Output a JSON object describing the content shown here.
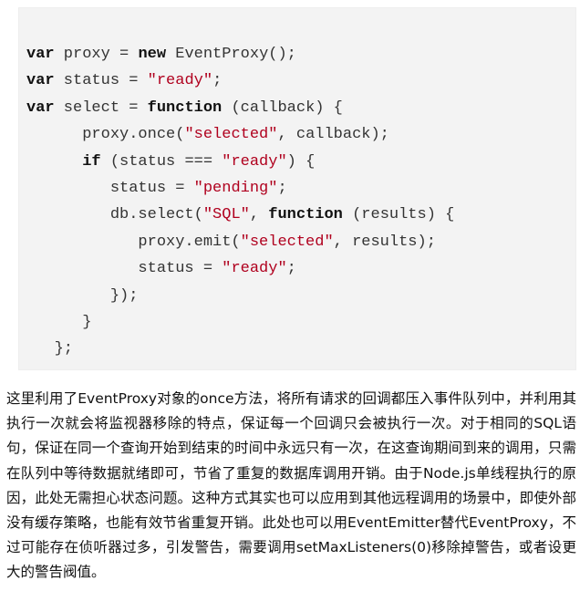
{
  "code": {
    "lines": [
      [
        {
          "t": "var",
          "k": "kw"
        },
        {
          "t": " proxy = ",
          "k": "pl"
        },
        {
          "t": "new",
          "k": "kw"
        },
        {
          "t": " EventProxy();",
          "k": "pl"
        }
      ],
      [
        {
          "t": "var",
          "k": "kw"
        },
        {
          "t": " status = ",
          "k": "pl"
        },
        {
          "t": "\"ready\"",
          "k": "str"
        },
        {
          "t": ";",
          "k": "pl"
        }
      ],
      [
        {
          "t": "var",
          "k": "kw"
        },
        {
          "t": " select = ",
          "k": "pl"
        },
        {
          "t": "function",
          "k": "kw"
        },
        {
          "t": " (callback) {",
          "k": "pl"
        }
      ],
      [
        {
          "t": "      proxy.once(",
          "k": "pl"
        },
        {
          "t": "\"selected\"",
          "k": "str"
        },
        {
          "t": ", callback);",
          "k": "pl"
        }
      ],
      [
        {
          "t": "      ",
          "k": "pl"
        },
        {
          "t": "if",
          "k": "kw"
        },
        {
          "t": " (status === ",
          "k": "pl"
        },
        {
          "t": "\"ready\"",
          "k": "str"
        },
        {
          "t": ") {",
          "k": "pl"
        }
      ],
      [
        {
          "t": "         status = ",
          "k": "pl"
        },
        {
          "t": "\"pending\"",
          "k": "str"
        },
        {
          "t": ";",
          "k": "pl"
        }
      ],
      [
        {
          "t": "         db.select(",
          "k": "pl"
        },
        {
          "t": "\"SQL\"",
          "k": "str"
        },
        {
          "t": ", ",
          "k": "pl"
        },
        {
          "t": "function",
          "k": "kw"
        },
        {
          "t": " (results) {",
          "k": "pl"
        }
      ],
      [
        {
          "t": "            proxy.emit(",
          "k": "pl"
        },
        {
          "t": "\"selected\"",
          "k": "str"
        },
        {
          "t": ", results);",
          "k": "pl"
        }
      ],
      [
        {
          "t": "            status = ",
          "k": "pl"
        },
        {
          "t": "\"ready\"",
          "k": "str"
        },
        {
          "t": ";",
          "k": "pl"
        }
      ],
      [
        {
          "t": "         });",
          "k": "pl"
        }
      ],
      [
        {
          "t": "      }",
          "k": "pl"
        }
      ],
      [
        {
          "t": "   };",
          "k": "pl"
        }
      ]
    ]
  },
  "prose": {
    "text": "这里利用了EventProxy对象的once方法，将所有请求的回调都压入事件队列中，并利用其执行一次就会将监视器移除的特点，保证每一个回调只会被执行一次。对于相同的SQL语句，保证在同一个查询开始到结束的时间中永远只有一次，在这查询期间到来的调用，只需在队列中等待数据就绪即可，节省了重复的数据库调用开销。由于Node.js单线程执行的原因，此处无需担心状态问题。这种方式其实也可以应用到其他远程调用的场景中，即使外部没有缓存策略，也能有效节省重复开销。此处也可以用EventEmitter替代EventProxy，不过可能存在侦听器过多，引发警告，需要调用setMaxListeners(0)移除掉警告，或者设更大的警告阀值。"
  }
}
